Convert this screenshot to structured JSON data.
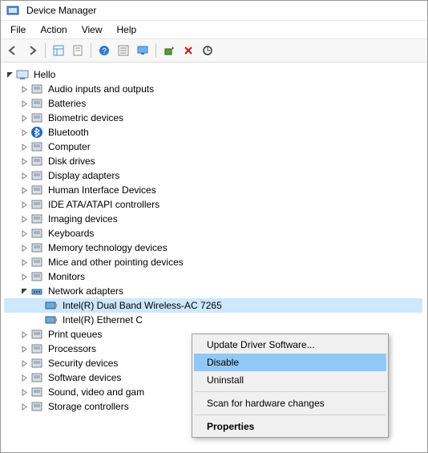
{
  "window": {
    "title": "Device Manager"
  },
  "menu": {
    "file": "File",
    "action": "Action",
    "view": "View",
    "help": "Help"
  },
  "root": {
    "name": "Hello"
  },
  "categories": [
    {
      "name": "Audio inputs and outputs",
      "icon": "speaker-icon",
      "exp": false
    },
    {
      "name": "Batteries",
      "icon": "battery-icon",
      "exp": false
    },
    {
      "name": "Biometric devices",
      "icon": "fingerprint-icon",
      "exp": false
    },
    {
      "name": "Bluetooth",
      "icon": "bluetooth-icon",
      "exp": false
    },
    {
      "name": "Computer",
      "icon": "computer-icon",
      "exp": false
    },
    {
      "name": "Disk drives",
      "icon": "disk-icon",
      "exp": false
    },
    {
      "name": "Display adapters",
      "icon": "display-icon",
      "exp": false
    },
    {
      "name": "Human Interface Devices",
      "icon": "hid-icon",
      "exp": false
    },
    {
      "name": "IDE ATA/ATAPI controllers",
      "icon": "ide-icon",
      "exp": false
    },
    {
      "name": "Imaging devices",
      "icon": "camera-icon",
      "exp": false
    },
    {
      "name": "Keyboards",
      "icon": "keyboard-icon",
      "exp": false
    },
    {
      "name": "Memory technology devices",
      "icon": "memory-icon",
      "exp": false
    },
    {
      "name": "Mice and other pointing devices",
      "icon": "mouse-icon",
      "exp": false
    },
    {
      "name": "Monitors",
      "icon": "monitor-icon",
      "exp": false
    },
    {
      "name": "Network adapters",
      "icon": "network-icon",
      "exp": true,
      "children": [
        {
          "name": "Intel(R) Dual Band Wireless-AC 7265",
          "icon": "nic-icon",
          "selected": true
        },
        {
          "name": "Intel(R) Ethernet Connection",
          "icon": "nic-icon",
          "selected": false,
          "truncated": "Intel(R) Ethernet C"
        }
      ]
    },
    {
      "name": "Print queues",
      "icon": "printer-icon",
      "exp": false
    },
    {
      "name": "Processors",
      "icon": "cpu-icon",
      "exp": false
    },
    {
      "name": "Security devices",
      "icon": "security-icon",
      "exp": false
    },
    {
      "name": "Software devices",
      "icon": "software-icon",
      "exp": false
    },
    {
      "name": "Sound, video and game controllers",
      "icon": "sound-icon",
      "exp": false,
      "truncated": "Sound, video and gam"
    },
    {
      "name": "Storage controllers",
      "icon": "storage-icon",
      "exp": false
    }
  ],
  "contextMenu": {
    "update": "Update Driver Software...",
    "disable": "Disable",
    "uninstall": "Uninstall",
    "scan": "Scan for hardware changes",
    "properties": "Properties"
  },
  "toolbarIcons": [
    "back",
    "forward",
    "show-hidden",
    "properties",
    "help",
    "action",
    "monitor",
    "add-hw",
    "remove",
    "scan"
  ]
}
